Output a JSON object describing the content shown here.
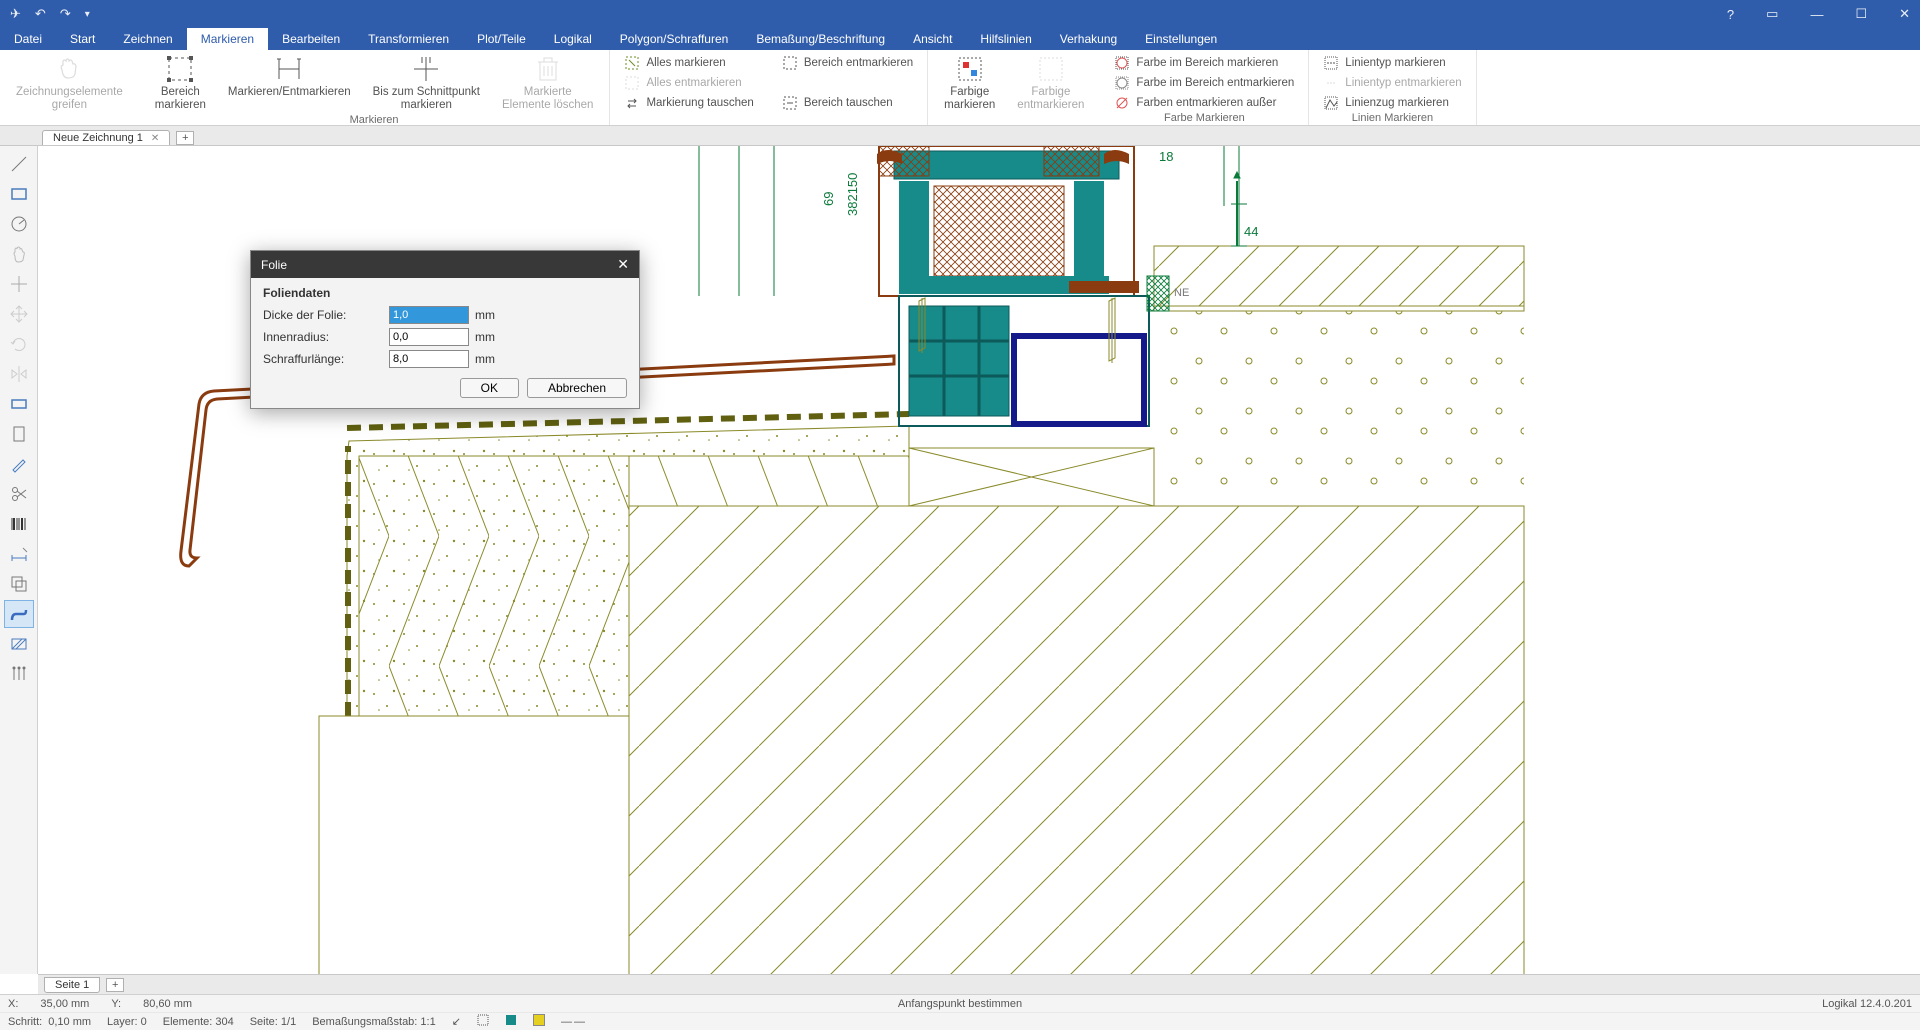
{
  "qat": {
    "send": "send",
    "undo": "undo",
    "redo": "redo",
    "more": "more"
  },
  "win": {
    "help": "?",
    "box": "▭",
    "min": "—",
    "max": "☐",
    "close": "✕"
  },
  "menu": [
    "Datei",
    "Start",
    "Zeichnen",
    "Markieren",
    "Bearbeiten",
    "Transformieren",
    "Plot/Teile",
    "Logikal",
    "Polygon/Schraffuren",
    "Bemaßung/Beschriftung",
    "Ansicht",
    "Hilfslinien",
    "Verhakung",
    "Einstellungen"
  ],
  "menuActive": 3,
  "ribbon": {
    "g1": {
      "b1": "Zeichnungselemente\ngreifen",
      "b2": "Bereich\nmarkieren",
      "b3": "Markieren/Entmarkieren",
      "b4": "Bis zum Schnittpunkt\nmarkieren",
      "b5": "Markierte\nElemente löschen",
      "label": "Markieren"
    },
    "g2": {
      "s1": "Alles markieren",
      "s2": "Alles entmarkieren",
      "s3": "Markierung tauschen"
    },
    "g3": {
      "s1": "Bereich entmarkieren",
      "s2": "Bereich tauschen"
    },
    "g4": {
      "b1": "Farbige\nmarkieren",
      "b2": "Farbige\nentmarkieren"
    },
    "g5": {
      "s1": "Farbe im Bereich markieren",
      "s2": "Farbe im Bereich entmarkieren",
      "s3": "Farben entmarkieren außer",
      "label": "Farbe Markieren"
    },
    "g6": {
      "s1": "Linientyp markieren",
      "s2": "Linientyp entmarkieren",
      "s3": "Linienzug markieren",
      "label": "Linien Markieren"
    }
  },
  "doctab": "Neue Zeichnung 1",
  "dialog": {
    "title": "Folie",
    "section": "Foliendaten",
    "rows": [
      {
        "label": "Dicke der Folie:",
        "value": "1,0",
        "unit": "mm",
        "sel": true
      },
      {
        "label": "Innenradius:",
        "value": "0,0",
        "unit": "mm",
        "sel": false
      },
      {
        "label": "Schraffurlänge:",
        "value": "8,0",
        "unit": "mm",
        "sel": false
      }
    ],
    "ok": "OK",
    "cancel": "Abbrechen"
  },
  "pagetab": "Seite 1",
  "status1": {
    "xlab": "X:",
    "xval": "35,00 mm",
    "ylab": "Y:",
    "yval": "80,60 mm",
    "prompt": "Anfangspunkt bestimmen",
    "ver": "Logikal 12.4.0.201"
  },
  "status2": {
    "schritt": "Schritt:",
    "schrittv": "0,10 mm",
    "layer": "Layer: 0",
    "elem": "Elemente: 304",
    "seite": "Seite: 1/1",
    "mass": "Bemaßungsmaßstab: 1:1"
  },
  "canvas_labels": {
    "a": "69",
    "b": "382150",
    "c": "18",
    "d": "44",
    "e": "NE"
  }
}
